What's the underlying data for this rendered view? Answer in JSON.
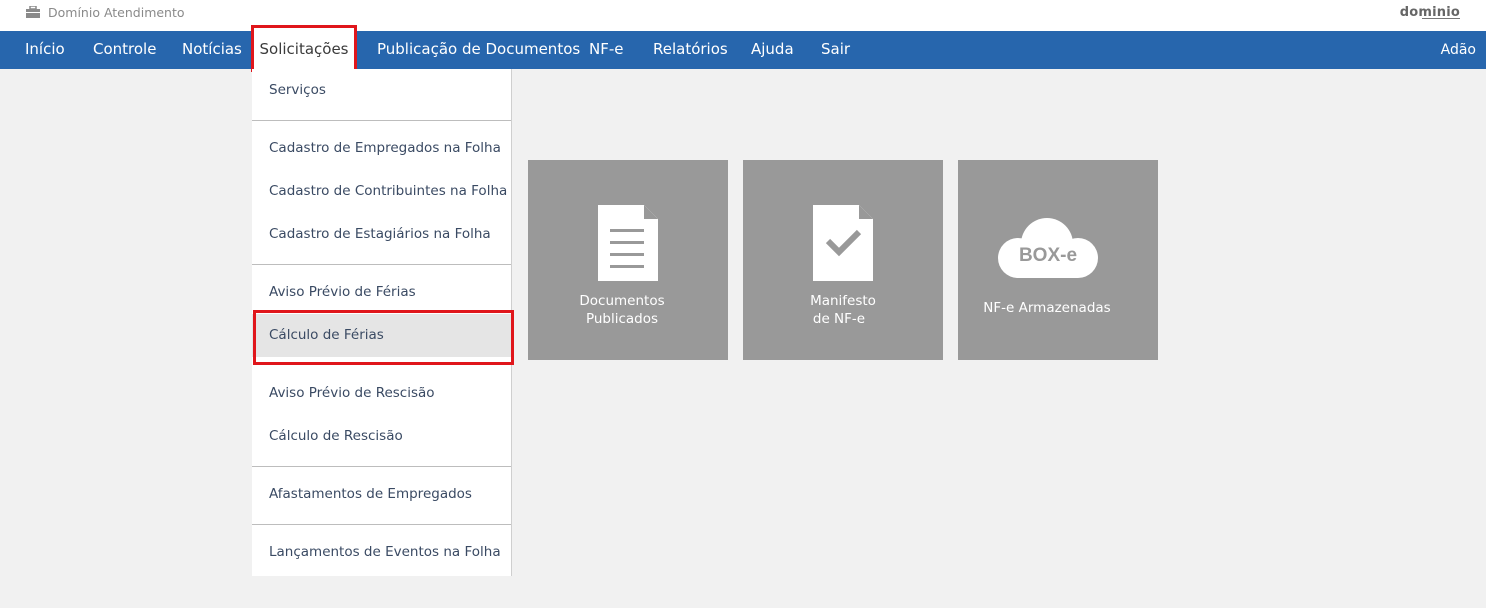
{
  "app": {
    "title": "Domínio Atendimento",
    "brand": "dominio",
    "user": "Adão"
  },
  "nav": {
    "items": [
      {
        "label": "Início"
      },
      {
        "label": "Controle"
      },
      {
        "label": "Notícias"
      },
      {
        "label": "Solicitações",
        "active": true
      },
      {
        "label": "Publicação de Documentos"
      },
      {
        "label": "NF-e"
      },
      {
        "label": "Relatórios"
      },
      {
        "label": "Ajuda"
      },
      {
        "label": "Sair"
      }
    ]
  },
  "dropdown": {
    "items": [
      {
        "label": "Serviços"
      },
      {
        "label": "Cadastro de Empregados na Folha"
      },
      {
        "label": "Cadastro de Contribuintes na Folha"
      },
      {
        "label": "Cadastro de Estagiários na Folha"
      },
      {
        "label": "Aviso Prévio de Férias"
      },
      {
        "label": "Cálculo de Férias",
        "selected": true
      },
      {
        "label": "Aviso Prévio de Rescisão"
      },
      {
        "label": "Cálculo de Rescisão"
      },
      {
        "label": "Afastamentos de Empregados"
      },
      {
        "label": "Lançamentos de Eventos na Folha"
      }
    ]
  },
  "tiles": [
    {
      "line1": "Documentos",
      "line2": "Publicados",
      "icon": "document-icon"
    },
    {
      "line1": "Manifesto",
      "line2": "de NF-e",
      "icon": "document-check-icon"
    },
    {
      "label": "NF-e Armazenadas",
      "icon_text": "BOX-e",
      "icon": "cloud-box-icon"
    }
  ],
  "colors": {
    "nav_bg": "#2766ad",
    "highlight": "#e0161b",
    "tile_bg": "#999999",
    "page_bg": "#f1f1f1"
  }
}
